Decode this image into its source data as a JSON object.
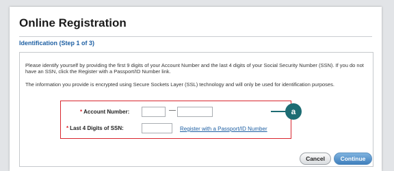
{
  "page": {
    "title": "Online Registration",
    "step_label": "Identification (Step 1 of 3)"
  },
  "instructions": {
    "paragraph1": "Please identify yourself by providing the first 9 digits of your Account Number and the last 4 digits of your Social Security Number (SSN). If you do not have an SSN, click the Register with a Passport/ID Number link.",
    "paragraph2": "The information you provide is encrypted using Secure Sockets Layer (SSL) technology and will only be used for identification purposes."
  },
  "form": {
    "required_marker": "*",
    "account_number_label": "Account Number:",
    "account_separator": "—",
    "account_part1_value": "",
    "account_part2_value": "",
    "ssn_label": "Last 4 Digits of SSN:",
    "ssn_value": "",
    "passport_link": "Register with a Passport/ID Number"
  },
  "callout": {
    "label": "a",
    "color": "#1d6c73"
  },
  "buttons": {
    "cancel": "Cancel",
    "continue": "Continue"
  },
  "colors": {
    "highlight_border": "#d9242c",
    "link": "#1d5fa3",
    "step_heading": "#1d5fa3"
  }
}
